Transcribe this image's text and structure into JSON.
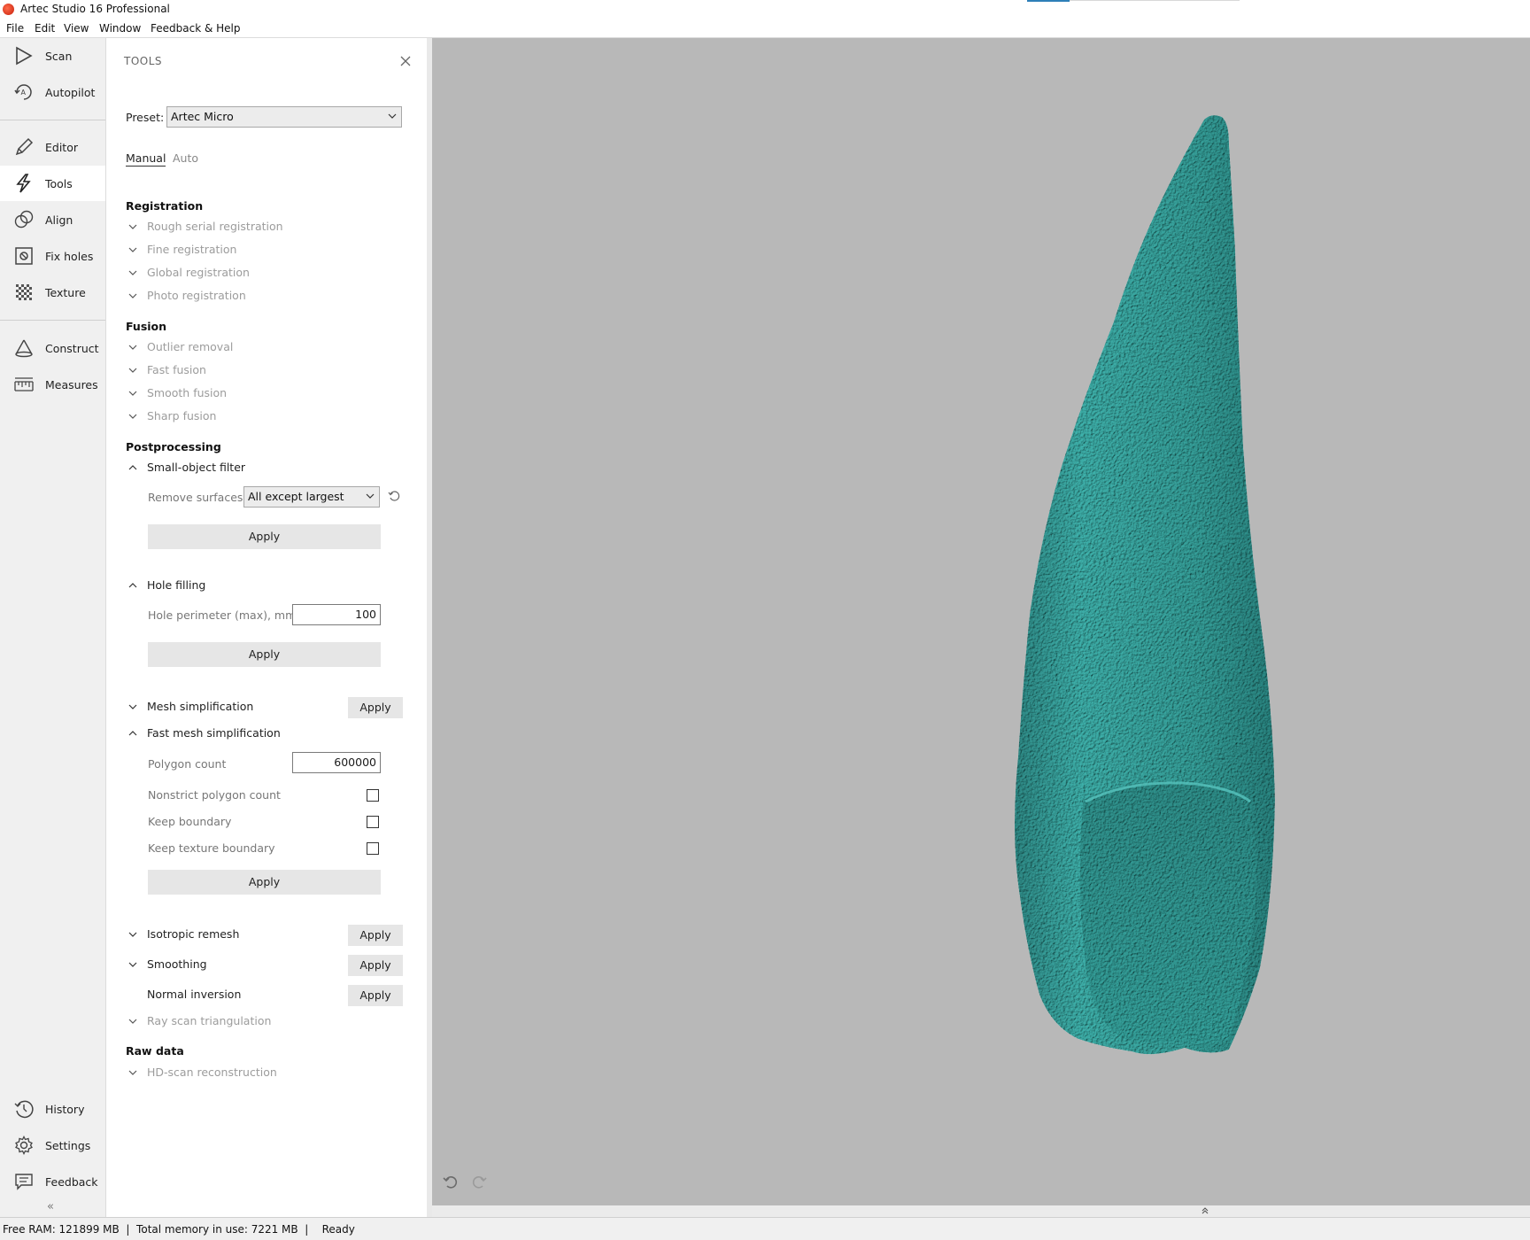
{
  "window": {
    "title": "Artec Studio 16 Professional"
  },
  "menu": [
    "File",
    "Edit",
    "View",
    "Window",
    "Feedback & Help"
  ],
  "rail": {
    "items": [
      {
        "label": "Scan",
        "icon": "play-icon"
      },
      {
        "label": "Autopilot",
        "icon": "autopilot-icon"
      },
      {
        "label": "Editor",
        "icon": "pencil-icon"
      },
      {
        "label": "Tools",
        "icon": "lightning-icon",
        "active": true
      },
      {
        "label": "Align",
        "icon": "align-icon"
      },
      {
        "label": "Fix holes",
        "icon": "fix-holes-icon"
      },
      {
        "label": "Texture",
        "icon": "texture-icon"
      },
      {
        "label": "Construct",
        "icon": "cone-icon"
      },
      {
        "label": "Measures",
        "icon": "ruler-icon"
      }
    ],
    "bottom_items": [
      {
        "label": "History",
        "icon": "history-icon"
      },
      {
        "label": "Settings",
        "icon": "gear-icon"
      },
      {
        "label": "Feedback",
        "icon": "chat-icon"
      }
    ],
    "collapse": "«"
  },
  "panel": {
    "title": "TOOLS",
    "preset_label": "Preset:",
    "preset_value": "Artec Micro",
    "tabs": {
      "manual": "Manual",
      "auto": "Auto"
    },
    "registration": {
      "title": "Registration",
      "items": [
        "Rough serial registration",
        "Fine registration",
        "Global registration",
        "Photo registration"
      ]
    },
    "fusion": {
      "title": "Fusion",
      "items": [
        "Outlier removal",
        "Fast fusion",
        "Smooth fusion",
        "Sharp fusion"
      ]
    },
    "postprocessing": {
      "title": "Postprocessing",
      "small_object_filter": {
        "label": "Small-object filter",
        "remove_label": "Remove surfaces",
        "remove_value": "All except largest",
        "apply": "Apply"
      },
      "hole_filling": {
        "label": "Hole filling",
        "perimeter_label": "Hole perimeter (max), mm",
        "perimeter_value": "100",
        "apply": "Apply"
      },
      "mesh_simplification": {
        "label": "Mesh simplification",
        "apply": "Apply"
      },
      "fast_mesh_simplification": {
        "label": "Fast mesh simplification",
        "polygon_label": "Polygon count",
        "polygon_value": "600000",
        "nonstrict_label": "Nonstrict polygon count",
        "keep_boundary_label": "Keep boundary",
        "keep_texture_label": "Keep texture boundary",
        "apply": "Apply"
      },
      "isotropic_remesh": {
        "label": "Isotropic remesh",
        "apply": "Apply"
      },
      "smoothing": {
        "label": "Smoothing",
        "apply": "Apply"
      },
      "normal_inversion": {
        "label": "Normal inversion",
        "apply": "Apply"
      },
      "ray_scan": {
        "label": "Ray scan triangulation"
      }
    },
    "raw_data": {
      "title": "Raw data",
      "items": [
        "HD-scan reconstruction"
      ]
    }
  },
  "status": {
    "text": "Free RAM: 121899 MB  |  Total memory in use: 7221 MB  |    Ready"
  },
  "colors": {
    "model": "#3a9f9a",
    "viewport": "#b8b8b8",
    "accent": "#2e7fb8"
  }
}
